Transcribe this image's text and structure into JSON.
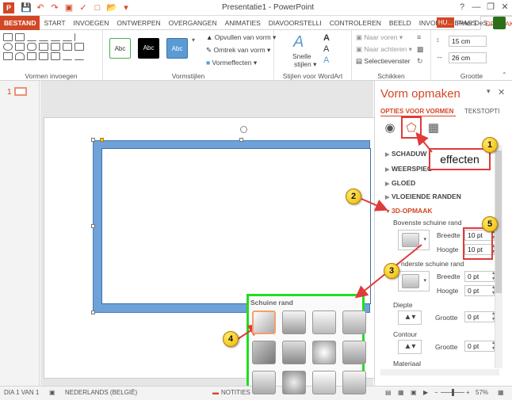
{
  "window": {
    "app_icon_letter": "P",
    "title": "Presentatie1 - PowerPoint",
    "controls": [
      "?",
      "—",
      "❐",
      "✕"
    ]
  },
  "tabs": [
    "BESTAND",
    "START",
    "INVOEGEN",
    "ONTWERPEN",
    "OVERGANGEN",
    "ANIMATIES",
    "DIAVOORSTELLI",
    "CONTROLEREN",
    "BEELD",
    "INVOEGTOEPASS",
    "OPMAAK"
  ],
  "active_tab": "OPMAAK",
  "account": {
    "badge": "HU...",
    "name": "Peter DeS..."
  },
  "ribbon": {
    "groups": {
      "shapes": "Vormen invoegen",
      "styles": "Vormstijlen",
      "wordart": "Stijlen voor WordArt",
      "arrange": "Schikken",
      "size": "Grootte"
    },
    "style_boxes": [
      {
        "label": "Abc",
        "bg": "#ffffff",
        "fg": "#333333",
        "border": "#4caf50"
      },
      {
        "label": "Abc",
        "bg": "#000000",
        "fg": "#ffffff",
        "border": "#000000"
      },
      {
        "label": "Abc",
        "bg": "#5b9bd5",
        "fg": "#ffffff",
        "border": "#41719c"
      }
    ],
    "fill_btn": "Opvullen van vorm",
    "outline_btn": "Omtrek van vorm",
    "effects_btn": "Vormeffecten",
    "quick_styles_1": "Snelle",
    "quick_styles_2": "stijlen",
    "bring_forward": "Naar voren",
    "send_backward": "Naar achteren",
    "selection_pane": "Selectievenster",
    "height": "15 cm",
    "width": "26 cm"
  },
  "thumbnail": {
    "number": "1"
  },
  "bevel_popup": {
    "title": "Schuine rand",
    "count": 12
  },
  "pane": {
    "title": "Vorm opmaken",
    "tab_shape": "OPTIES VOOR VORMEN",
    "tab_text": "TEKSTOPTI",
    "sections": [
      {
        "label": "SCHADUW",
        "active": false
      },
      {
        "label": "WEERSPIEG",
        "active": false
      },
      {
        "label": "GLOED",
        "active": false
      },
      {
        "label": "VLOEIENDE RANDEN",
        "active": false
      },
      {
        "label": "3D-OPMAAK",
        "active": true
      }
    ],
    "top_bevel": "Bovenste schuine rand",
    "bottom_bevel": "nderste schuine rand",
    "width_label": "Breedte",
    "height_label": "Hoogte",
    "top_width": "10 pt",
    "top_height": "10 pt",
    "bottom_width": "0 pt",
    "bottom_height": "0 pt",
    "depth": "Diepte",
    "contour": "Contour",
    "size_label": "Grootte",
    "depth_size": "0 pt",
    "contour_size": "0 pt",
    "material": "Materiaal"
  },
  "status": {
    "slide": "DIA 1 VAN 1",
    "language": "NEDERLANDS (BELGIË)",
    "notes": "NOTITIES",
    "zoom": "57%"
  },
  "annotations": {
    "callout": "effecten",
    "badges": [
      "1",
      "2",
      "3",
      "4",
      "5"
    ]
  },
  "colors": {
    "accent": "#d24726",
    "highlight_red": "#e03a3a",
    "highlight_green": "#22dd22"
  }
}
